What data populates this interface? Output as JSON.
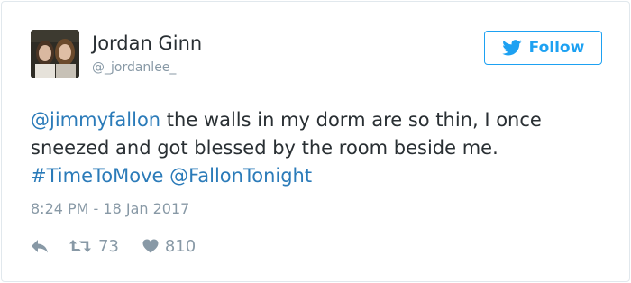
{
  "tweet": {
    "author": {
      "display_name": "Jordan Ginn",
      "handle": "@_jordanlee_"
    },
    "follow_button": {
      "label": "Follow",
      "icon": "twitter-bird-icon"
    },
    "text": {
      "mention_1": "@jimmyfallon",
      "body": " the walls in my dorm are so thin, I once sneezed and got blessed by the room beside me. ",
      "hashtag": "#TimeToMove",
      "space": " ",
      "mention_2": "@FallonTonight"
    },
    "timestamp": "8:24 PM - 18 Jan 2017",
    "actions": {
      "reply_icon": "reply-icon",
      "retweet_icon": "retweet-icon",
      "retweet_count": "73",
      "like_icon": "heart-icon",
      "like_count": "810"
    },
    "colors": {
      "text": "#292f33",
      "link": "#2b7bb9",
      "muted": "#8899a6",
      "brand": "#1da1f2",
      "border": "#e1e8ed"
    }
  }
}
